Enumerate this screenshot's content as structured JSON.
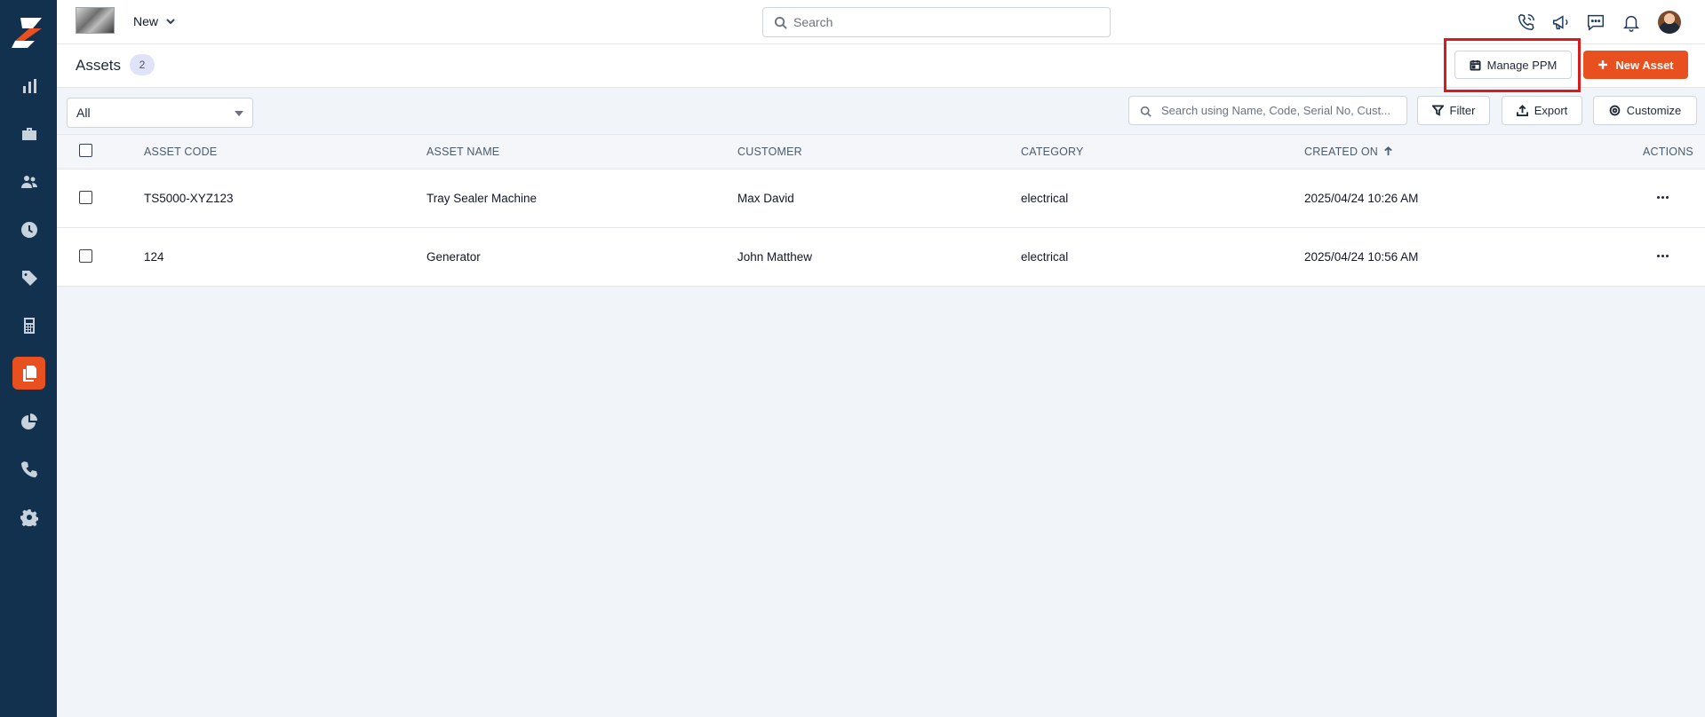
{
  "sidebar": {
    "items": [
      {
        "name": "dashboard",
        "icon": "bar-chart-icon"
      },
      {
        "name": "jobs",
        "icon": "briefcase-icon"
      },
      {
        "name": "customers",
        "icon": "users-icon"
      },
      {
        "name": "timesheets",
        "icon": "clock-icon"
      },
      {
        "name": "pricing",
        "icon": "tag-icon"
      },
      {
        "name": "invoices",
        "icon": "calculator-icon"
      },
      {
        "name": "assets",
        "icon": "documents-icon",
        "active": true
      },
      {
        "name": "reports",
        "icon": "pie-chart-icon"
      },
      {
        "name": "calls",
        "icon": "phone-icon"
      },
      {
        "name": "settings",
        "icon": "gear-icon"
      }
    ]
  },
  "topbar": {
    "workspace_label": "New",
    "search_placeholder": "Search"
  },
  "header": {
    "title": "Assets",
    "count": "2",
    "manage_ppm_label": "Manage PPM",
    "new_asset_label": "New Asset"
  },
  "toolbar": {
    "filter_value": "All",
    "search_placeholder": "Search using Name, Code, Serial No, Cust...",
    "filter_label": "Filter",
    "export_label": "Export",
    "customize_label": "Customize"
  },
  "table": {
    "columns": [
      "ASSET CODE",
      "ASSET NAME",
      "CUSTOMER",
      "CATEGORY",
      "CREATED ON",
      "ACTIONS"
    ],
    "rows": [
      {
        "code": "TS5000-XYZ123",
        "name": "Tray Sealer Machine",
        "customer": "Max David",
        "category": "electrical",
        "created": "2025/04/24 10:26 AM"
      },
      {
        "code": "124",
        "name": "Generator",
        "customer": "John Matthew",
        "category": "electrical",
        "created": "2025/04/24 10:56 AM"
      }
    ]
  },
  "colors": {
    "sidebar_bg": "#11314f",
    "accent": "#e9501f",
    "highlight": "#d81b1b"
  }
}
